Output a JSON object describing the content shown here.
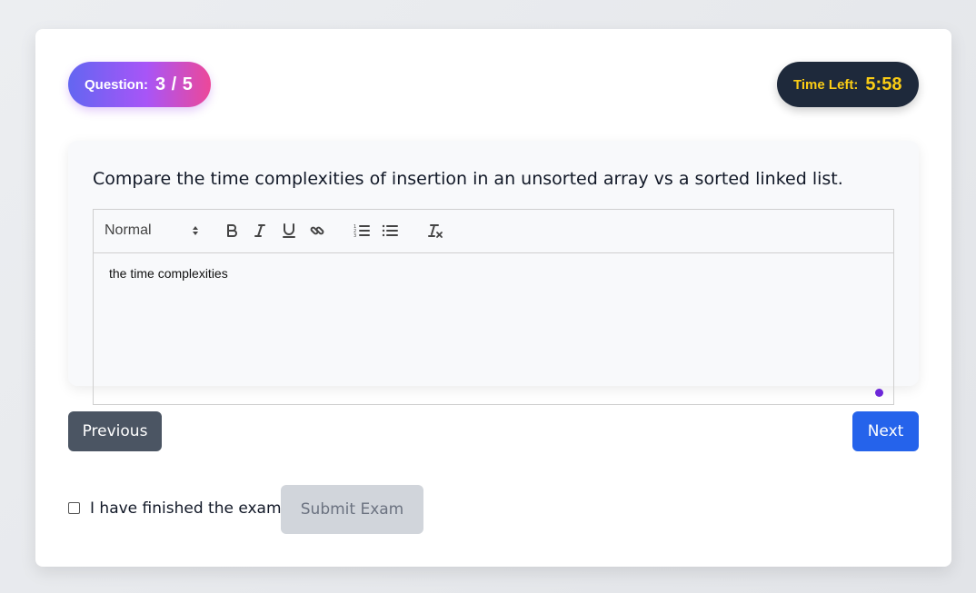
{
  "header": {
    "question_label": "Question:",
    "question_progress": "3 / 5",
    "time_label": "Time Left:",
    "time_value": "5:58"
  },
  "question": {
    "text": "Compare the time complexities of insertion in an unsorted array vs a sorted linked list."
  },
  "editor": {
    "format_select": "Normal",
    "toolbar_icons": [
      "bold-icon",
      "italic-icon",
      "underline-icon",
      "link-icon",
      "ordered-list-icon",
      "bullet-list-icon",
      "clear-format-icon"
    ],
    "content": "the time complexities"
  },
  "nav": {
    "previous_label": "Previous",
    "next_label": "Next"
  },
  "footer": {
    "finished_label": "I have finished the exam",
    "finished_checked": false,
    "submit_label": "Submit Exam"
  },
  "colors": {
    "accent_blue": "#2563eb",
    "timer_bg": "#1e293b",
    "timer_text": "#facc15",
    "prev_bg": "#4b5563",
    "submit_disabled_bg": "#d1d5db"
  }
}
